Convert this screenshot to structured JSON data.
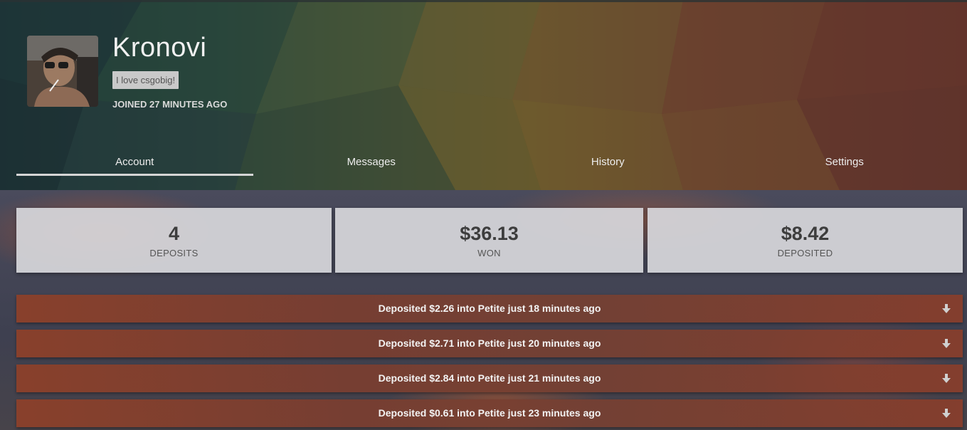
{
  "profile": {
    "username": "Kronovi",
    "bio": "I love csgobig!",
    "joined": "JOINED 27 MINUTES AGO",
    "avatar_icon": "user-photo"
  },
  "tabs": [
    {
      "label": "Account",
      "active": true
    },
    {
      "label": "Messages",
      "active": false
    },
    {
      "label": "History",
      "active": false
    },
    {
      "label": "Settings",
      "active": false
    }
  ],
  "stats": [
    {
      "value": "4",
      "label": "DEPOSITS"
    },
    {
      "value": "$36.13",
      "label": "WON"
    },
    {
      "value": "$8.42",
      "label": "DEPOSITED"
    }
  ],
  "deposits": [
    {
      "text": "Deposited $2.26 into Petite just 18 minutes ago",
      "icon": "arrow-down-icon"
    },
    {
      "text": "Deposited $2.71 into Petite just 20 minutes ago",
      "icon": "arrow-down-icon"
    },
    {
      "text": "Deposited $2.84 into Petite just 21 minutes ago",
      "icon": "arrow-down-icon"
    },
    {
      "text": "Deposited $0.61 into Petite just 23 minutes ago",
      "icon": "arrow-down-icon"
    }
  ],
  "colors": {
    "deposit_row": "#8c402a",
    "stat_card": "#d6d6da",
    "tab_indicator": "#d5d5d5"
  }
}
